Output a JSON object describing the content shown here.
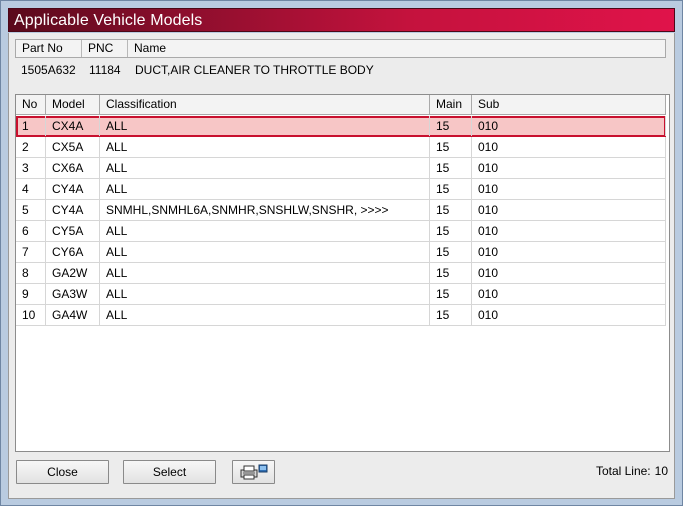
{
  "window": {
    "title": "Applicable Vehicle Models"
  },
  "part_header": {
    "columns": [
      "Part No",
      "PNC",
      "Name"
    ],
    "values": {
      "part_no": "1505A632",
      "pnc": "11184",
      "name": "DUCT,AIR CLEANER TO THROTTLE BODY"
    }
  },
  "table": {
    "columns": [
      "No",
      "Model",
      "Classification",
      "Main",
      "Sub"
    ],
    "rows": [
      {
        "no": "1",
        "model": "CX4A",
        "classification": "ALL",
        "main": "15",
        "sub": "010"
      },
      {
        "no": "2",
        "model": "CX5A",
        "classification": "ALL",
        "main": "15",
        "sub": "010"
      },
      {
        "no": "3",
        "model": "CX6A",
        "classification": "ALL",
        "main": "15",
        "sub": "010"
      },
      {
        "no": "4",
        "model": "CY4A",
        "classification": "ALL",
        "main": "15",
        "sub": "010"
      },
      {
        "no": "5",
        "model": "CY4A",
        "classification": "SNMHL,SNMHL6A,SNMHR,SNSHLW,SNSHR,  >>>>",
        "main": "15",
        "sub": "010"
      },
      {
        "no": "6",
        "model": "CY5A",
        "classification": "ALL",
        "main": "15",
        "sub": "010"
      },
      {
        "no": "7",
        "model": "CY6A",
        "classification": "ALL",
        "main": "15",
        "sub": "010"
      },
      {
        "no": "8",
        "model": "GA2W",
        "classification": "ALL",
        "main": "15",
        "sub": "010"
      },
      {
        "no": "9",
        "model": "GA3W",
        "classification": "ALL",
        "main": "15",
        "sub": "010"
      },
      {
        "no": "10",
        "model": "GA4W",
        "classification": "ALL",
        "main": "15",
        "sub": "010"
      }
    ],
    "selected_row": "1"
  },
  "footer": {
    "close_label": "Close",
    "select_label": "Select",
    "print_icon": "printer-icon",
    "total_label": "Total Line:",
    "total_value": "10"
  },
  "colors": {
    "title_gradient_start": "#5a0a1c",
    "title_gradient_end": "#e0134a",
    "selected_row_bg": "#f7c6c6",
    "selected_row_border": "#c8102e"
  }
}
